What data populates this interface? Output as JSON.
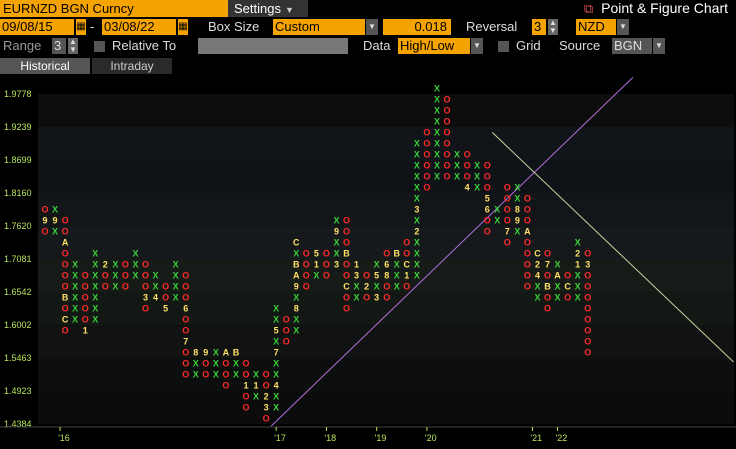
{
  "header": {
    "ticker": "EURNZD BGN Curncy",
    "settings_label": "Settings",
    "title": "Point & Figure Chart"
  },
  "controls": {
    "start_date": "09/08/15",
    "end_date": "03/08/22",
    "box_size_label": "Box Size",
    "box_size_mode": "Custom",
    "box_size_value": "0.018",
    "reversal_label": "Reversal",
    "reversal_value": "3",
    "currency": "NZD",
    "range_label": "Range",
    "range_value": "3",
    "relative_to_label": "Relative To",
    "data_label": "Data",
    "data_value": "High/Low",
    "grid_label": "Grid",
    "source_label": "Source",
    "source_value": "BGN"
  },
  "tabs": [
    "Historical",
    "Intraday"
  ],
  "chart_data": {
    "type": "point-and-figure",
    "y_ticks": [
      "1.9778",
      "1.9239",
      "1.8699",
      "1.8160",
      "1.7620",
      "1.7081",
      "1.6542",
      "1.6002",
      "1.5463",
      "1.4923",
      "1.4384"
    ],
    "ylim": [
      1.4384,
      1.9778
    ],
    "box_size": 0.018,
    "x_ticks": [
      {
        "col": 1.5,
        "label": "'16"
      },
      {
        "col": 23,
        "label": "'17"
      },
      {
        "col": 28,
        "label": "'18"
      },
      {
        "col": 33,
        "label": "'19"
      },
      {
        "col": 38,
        "label": "'20"
      },
      {
        "col": 48.5,
        "label": "'21"
      },
      {
        "col": 51,
        "label": "'22"
      }
    ],
    "colors": {
      "x": "#3ad03a",
      "o": "#ff2a2a",
      "month": "#ffe066",
      "trend": "#b070e0",
      "trend2": "#c8d0a0"
    },
    "columns": [
      {
        "t": "O",
        "top": 1.789,
        "bottom": 1.753,
        "marks": {
          "1.7710": "9"
        }
      },
      {
        "t": "X",
        "top": 1.789,
        "bottom": 1.753,
        "marks": {
          "1.7710": "9"
        }
      },
      {
        "t": "O",
        "top": 1.771,
        "bottom": 1.591,
        "marks": {
          "1.7350": "A",
          "1.6450": "B",
          "1.6090": "C"
        }
      },
      {
        "t": "X",
        "top": 1.699,
        "bottom": 1.609,
        "marks": {}
      },
      {
        "t": "O",
        "top": 1.681,
        "bottom": 1.591,
        "marks": {
          "1.5910": "1"
        }
      },
      {
        "t": "X",
        "top": 1.717,
        "bottom": 1.609,
        "marks": {}
      },
      {
        "t": "O",
        "top": 1.699,
        "bottom": 1.663,
        "marks": {
          "1.6990": "2"
        }
      },
      {
        "t": "X",
        "top": 1.699,
        "bottom": 1.663,
        "marks": {}
      },
      {
        "t": "O",
        "top": 1.699,
        "bottom": 1.663,
        "marks": {}
      },
      {
        "t": "X",
        "top": 1.717,
        "bottom": 1.681,
        "marks": {}
      },
      {
        "t": "O",
        "top": 1.699,
        "bottom": 1.627,
        "marks": {
          "1.6450": "3"
        }
      },
      {
        "t": "X",
        "top": 1.681,
        "bottom": 1.645,
        "marks": {
          "1.6450": "4"
        }
      },
      {
        "t": "O",
        "top": 1.663,
        "bottom": 1.627,
        "marks": {
          "1.6270": "5"
        }
      },
      {
        "t": "X",
        "top": 1.699,
        "bottom": 1.645,
        "marks": {}
      },
      {
        "t": "O",
        "top": 1.681,
        "bottom": 1.519,
        "marks": {
          "1.6270": "6",
          "1.5730": "7"
        }
      },
      {
        "t": "X",
        "top": 1.555,
        "bottom": 1.519,
        "marks": {
          "1.5550": "8"
        }
      },
      {
        "t": "O",
        "top": 1.555,
        "bottom": 1.519,
        "marks": {
          "1.5550": "9"
        }
      },
      {
        "t": "X",
        "top": 1.555,
        "bottom": 1.519,
        "marks": {}
      },
      {
        "t": "O",
        "top": 1.555,
        "bottom": 1.501,
        "marks": {
          "1.5550": "A"
        }
      },
      {
        "t": "X",
        "top": 1.555,
        "bottom": 1.519,
        "marks": {
          "1.5550": "B"
        }
      },
      {
        "t": "O",
        "top": 1.537,
        "bottom": 1.465,
        "marks": {
          "1.5010": "C",
          "1.5010x": "1"
        }
      },
      {
        "t": "X",
        "top": 1.519,
        "bottom": 1.483,
        "marks": {
          "1.5010": "1"
        }
      },
      {
        "t": "O",
        "top": 1.519,
        "bottom": 1.447,
        "marks": {
          "1.4830": "2",
          "1.4650": "3"
        }
      },
      {
        "t": "X",
        "top": 1.627,
        "bottom": 1.465,
        "marks": {
          "1.5010": "4",
          "1.5910": "5",
          "1.5550": "7"
        }
      },
      {
        "t": "O",
        "top": 1.609,
        "bottom": 1.573,
        "marks": {}
      },
      {
        "t": "X",
        "top": 1.735,
        "bottom": 1.591,
        "marks": {
          "1.7350": "C",
          "1.6990": "B",
          "1.6810": "A",
          "1.6630": "9",
          "1.6270": "8"
        }
      },
      {
        "t": "O",
        "top": 1.717,
        "bottom": 1.663,
        "marks": {}
      },
      {
        "t": "X",
        "top": 1.717,
        "bottom": 1.681,
        "marks": {
          "1.7170": "5",
          "1.6990": "1"
        }
      },
      {
        "t": "O",
        "top": 1.717,
        "bottom": 1.681,
        "marks": {}
      },
      {
        "t": "X",
        "top": 1.771,
        "bottom": 1.699,
        "marks": {
          "1.7530": "9",
          "1.6990": "3"
        }
      },
      {
        "t": "O",
        "top": 1.771,
        "bottom": 1.627,
        "marks": {
          "1.7170": "B",
          "1.6630": "C"
        }
      },
      {
        "t": "X",
        "top": 1.699,
        "bottom": 1.645,
        "marks": {
          "1.6990": "1",
          "1.6810": "3"
        }
      },
      {
        "t": "O",
        "top": 1.681,
        "bottom": 1.645,
        "marks": {
          "1.6630": "2"
        }
      },
      {
        "t": "X",
        "top": 1.699,
        "bottom": 1.645,
        "marks": {
          "1.6810": "5",
          "1.6450": "3"
        }
      },
      {
        "t": "O",
        "top": 1.717,
        "bottom": 1.645,
        "marks": {
          "1.6990": "6",
          "1.6810": "8"
        }
      },
      {
        "t": "X",
        "top": 1.717,
        "bottom": 1.663,
        "marks": {
          "1.7350": "9",
          "1.7170": "B"
        }
      },
      {
        "t": "O",
        "top": 1.735,
        "bottom": 1.663,
        "marks": {
          "1.6990": "C",
          "1.6810": "1"
        }
      },
      {
        "t": "X",
        "top": 1.897,
        "bottom": 1.681,
        "marks": {
          "1.7890": "3",
          "1.7530": "2"
        }
      },
      {
        "t": "O",
        "top": 1.915,
        "bottom": 1.825,
        "marks": {}
      },
      {
        "t": "X",
        "top": 1.987,
        "bottom": 1.843,
        "marks": {}
      },
      {
        "t": "O",
        "top": 1.969,
        "bottom": 1.843,
        "marks": {}
      },
      {
        "t": "X",
        "top": 1.879,
        "bottom": 1.843,
        "marks": {}
      },
      {
        "t": "O",
        "top": 1.879,
        "bottom": 1.825,
        "marks": {
          "1.8250": "4"
        }
      },
      {
        "t": "X",
        "top": 1.861,
        "bottom": 1.825,
        "marks": {}
      },
      {
        "t": "O",
        "top": 1.861,
        "bottom": 1.753,
        "marks": {
          "1.8070": "5",
          "1.7890": "6"
        }
      },
      {
        "t": "X",
        "top": 1.789,
        "bottom": 1.771,
        "marks": {}
      },
      {
        "t": "O",
        "top": 1.825,
        "bottom": 1.735,
        "marks": {
          "1.7530": "7"
        }
      },
      {
        "t": "X",
        "top": 1.825,
        "bottom": 1.753,
        "marks": {
          "1.7890": "8",
          "1.7710": "9"
        }
      },
      {
        "t": "O",
        "top": 1.807,
        "bottom": 1.663,
        "marks": {
          "1.7530": "A"
        }
      },
      {
        "t": "X",
        "top": 1.717,
        "bottom": 1.645,
        "marks": {
          "1.7170": "C",
          "1.6990": "2",
          "1.6810": "4"
        }
      },
      {
        "t": "O",
        "top": 1.717,
        "bottom": 1.627,
        "marks": {
          "1.6990": "7",
          "1.6630": "B"
        }
      },
      {
        "t": "X",
        "top": 1.699,
        "bottom": 1.645,
        "marks": {
          "1.6810": "A"
        }
      },
      {
        "t": "O",
        "top": 1.681,
        "bottom": 1.645,
        "marks": {
          "1.6630": "C"
        }
      },
      {
        "t": "X",
        "top": 1.735,
        "bottom": 1.645,
        "marks": {
          "1.7170": "2",
          "1.6990": "1"
        }
      },
      {
        "t": "O",
        "top": 1.717,
        "bottom": 1.555,
        "marks": {
          "1.6990": "3"
        }
      }
    ]
  }
}
